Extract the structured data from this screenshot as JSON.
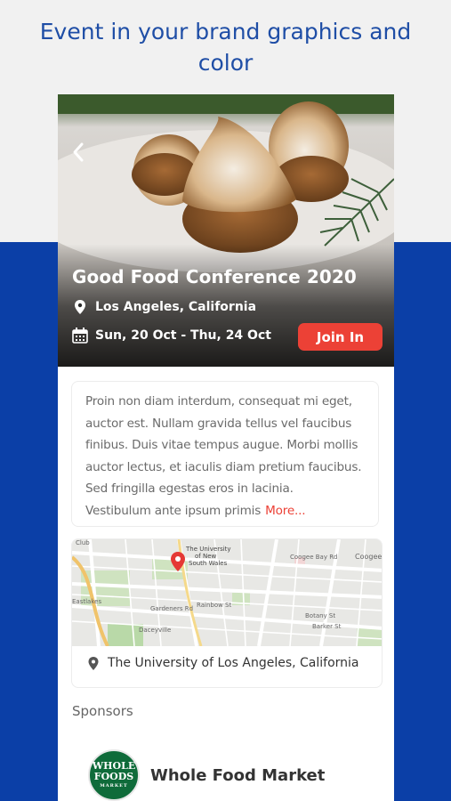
{
  "headline": "Event in your brand graphics and color",
  "event": {
    "title": "Good Food Conference 2020",
    "location": "Los Angeles, California",
    "dates": "Sun, 20 Oct - Thu, 24 Oct",
    "join_label": "Join In"
  },
  "description": {
    "lines": [
      "Proin non diam interdum, consequat mi eget,",
      "auctor est. Nullam gravida tellus vel faucibus",
      "finibus. Duis vitae tempus augue. Morbi mollis",
      "auctor lectus, et iaculis diam pretium faucibus.",
      "Sed fringilla egestas eros in lacinia.",
      "Vestibulum ante ipsum primis"
    ],
    "more_label": "More..."
  },
  "map": {
    "marker_label_lines": [
      "The University",
      "of New",
      "South Wales"
    ],
    "street_labels": [
      "Club",
      "Eastlakes",
      "Daceyville",
      "Gardeners Rd",
      "Rainbow St",
      "Coogee Bay Rd",
      "Coogee",
      "Botany St",
      "Barker St"
    ],
    "venue": "The University of Los Angeles, California"
  },
  "sponsors": {
    "label": "Sponsors",
    "items": [
      {
        "name": "Whole Food Market",
        "logo_lines": [
          "WHOLE",
          "FOODS",
          "MARKET"
        ]
      }
    ]
  },
  "colors": {
    "brand_blue": "#0b3fa7",
    "accent_red": "#ec4136",
    "headline_blue": "#1f4ea6"
  }
}
